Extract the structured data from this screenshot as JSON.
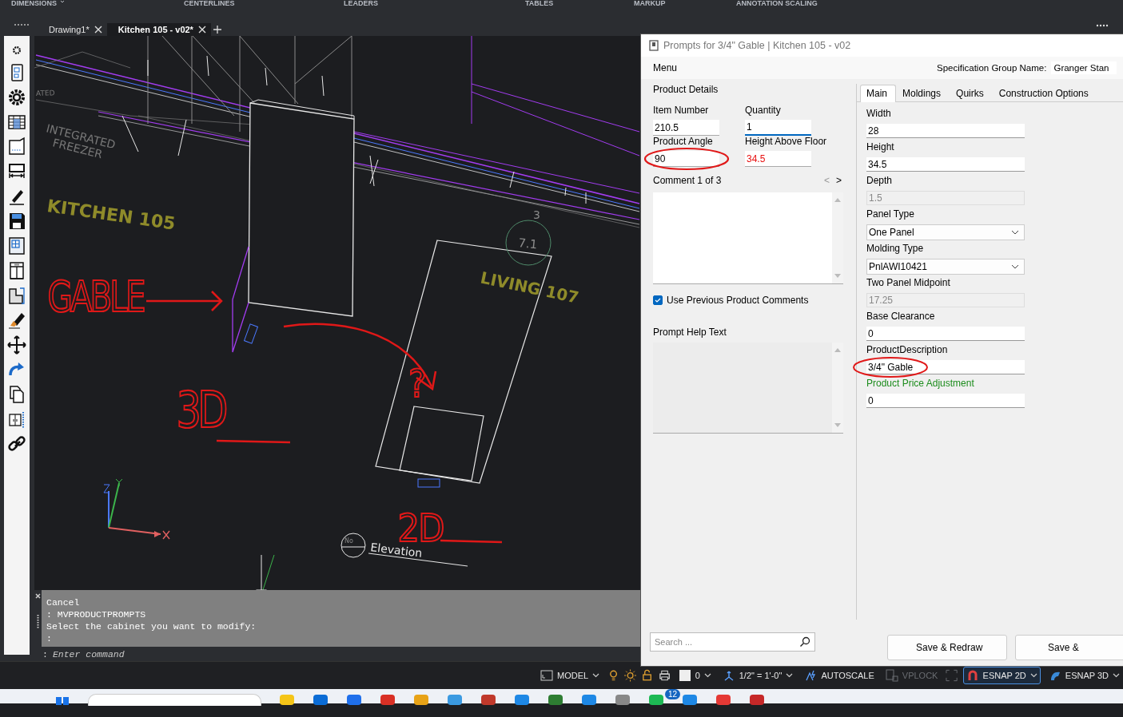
{
  "ribbon": {
    "groups": [
      "DIMENSIONS",
      "CENTERLINES",
      "LEADERS",
      "TABLES",
      "MARKUP",
      "ANNOTATION SCALING"
    ]
  },
  "doc_tabs": [
    {
      "label": "Drawing1*",
      "selected": false
    },
    {
      "label": "Kitchen 105 - v02*",
      "selected": true
    }
  ],
  "canvas": {
    "labels": [
      {
        "kind": "note",
        "text": "ATED"
      },
      {
        "kind": "note",
        "text": "INTEGRATED"
      },
      {
        "kind": "note",
        "text": "FREEZER"
      },
      {
        "kind": "room",
        "text": "KITCHEN 105"
      },
      {
        "kind": "room",
        "text": "LIVING 107"
      },
      {
        "kind": "tag",
        "text": "3"
      },
      {
        "kind": "tag",
        "text": "7.1"
      },
      {
        "kind": "elevation",
        "text": "Elevation"
      },
      {
        "kind": "tag",
        "text": "No"
      }
    ],
    "markup": [
      "GABLE",
      "3D",
      "?",
      "2D"
    ]
  },
  "command_line": {
    "history": [
      "Cancel",
      ": MVPRODUCTPROMPTS",
      "Select the cabinet you want to modify:",
      ":"
    ],
    "prompt": ":",
    "placeholder": "Enter command"
  },
  "dialog": {
    "title": "Prompts for 3/4\" Gable | Kitchen 105 - v02",
    "menu": "Menu",
    "spec_label": "Specification Group Name:",
    "spec_value": "Granger Stan",
    "section": "Product Details",
    "details": [
      {
        "label": "Item Number",
        "value": "210.5",
        "focused": false,
        "warning": false
      },
      {
        "label": "Quantity",
        "value": "1",
        "focused": true,
        "warning": false
      },
      {
        "label": "Product Angle",
        "value": "90",
        "focused": false,
        "warning": false
      },
      {
        "label": "Height Above Floor",
        "value": "34.5",
        "focused": false,
        "warning": true
      }
    ],
    "comment": {
      "label": "Comment 1 of 3",
      "prev": "<",
      "next": ">",
      "prev_disabled": true
    },
    "use_previous": {
      "label": "Use Previous Product Comments",
      "checked": true
    },
    "help_label": "Prompt Help Text",
    "tabs": [
      {
        "label": "Main",
        "selected": true
      },
      {
        "label": "Moldings",
        "selected": false
      },
      {
        "label": "Quirks",
        "selected": false
      },
      {
        "label": "Construction Options",
        "selected": false
      }
    ],
    "fields": [
      {
        "label": "Width",
        "value": "28",
        "kind": "text",
        "color": "#000000"
      },
      {
        "label": "Height",
        "value": "34.5",
        "kind": "text",
        "color": "#000000"
      },
      {
        "label": "Depth",
        "value": "1.5",
        "kind": "readonly",
        "color": "#000000"
      },
      {
        "label": "Panel Type",
        "value": "One Panel",
        "kind": "select",
        "color": "#000000"
      },
      {
        "label": "Molding Type",
        "value": "PnlAWI10421",
        "kind": "select",
        "color": "#000000"
      },
      {
        "label": "Two Panel Midpoint",
        "value": "17.25",
        "kind": "readonly",
        "color": "#000000"
      },
      {
        "label": "Base Clearance",
        "value": "0",
        "kind": "text",
        "color": "#000000"
      },
      {
        "label": "ProductDescription",
        "value": "3/4\" Gable",
        "kind": "text",
        "color": "#000000"
      },
      {
        "label": "Product Price Adjustment",
        "value": "0",
        "kind": "text",
        "color": "#1c8c1c"
      }
    ],
    "search": {
      "placeholder": "Search ..."
    },
    "buttons": [
      "Save & Redraw",
      "Save &"
    ]
  },
  "status_bar": [
    {
      "text": "MODEL",
      "dropdown": true,
      "disabled": false,
      "selected": false
    },
    {
      "text": "0",
      "dropdown": true,
      "disabled": false,
      "selected": false
    },
    {
      "text": "1/2\" = 1'-0\"",
      "dropdown": true,
      "disabled": false,
      "selected": false
    },
    {
      "text": "AUTOSCALE",
      "dropdown": false,
      "disabled": false,
      "selected": false
    },
    {
      "text": "VPLOCK",
      "dropdown": false,
      "disabled": true,
      "selected": false
    },
    {
      "text": "ESNAP 2D",
      "dropdown": true,
      "disabled": false,
      "selected": true
    },
    {
      "text": "ESNAP 3D",
      "dropdown": true,
      "disabled": false,
      "selected": false
    }
  ],
  "taskbar": {
    "badge": "12"
  }
}
